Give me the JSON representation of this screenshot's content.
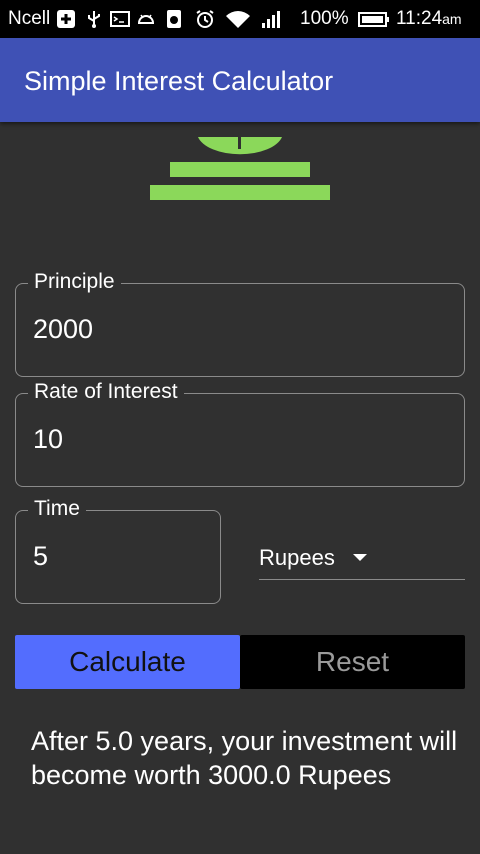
{
  "statusbar": {
    "carrier": "Ncell",
    "battery": "100%",
    "time": "11:24",
    "ampm": "am",
    "icons": [
      "plus-box-icon",
      "usb-icon",
      "terminal-icon",
      "android-icon",
      "bug-icon",
      "alarm-icon",
      "wifi-icon",
      "signal-icon",
      "battery-icon"
    ]
  },
  "appbar": {
    "title": "Simple Interest Calculator"
  },
  "colors": {
    "primary": "#3f51b5",
    "accent": "#536dfe",
    "logo_green": "#8bd85a",
    "background": "#303030"
  },
  "form": {
    "principle": {
      "label": "Principle",
      "value": "2000"
    },
    "rate": {
      "label": "Rate of Interest",
      "value": "10"
    },
    "time": {
      "label": "Time",
      "value": "5"
    },
    "currency": {
      "selected": "Rupees"
    }
  },
  "buttons": {
    "calculate": "Calculate",
    "reset": "Reset"
  },
  "result": {
    "text": "After 5.0 years, your investment will become worth 3000.0 Rupees"
  }
}
